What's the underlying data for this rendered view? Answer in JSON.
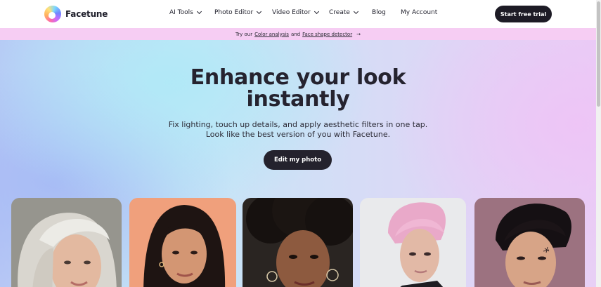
{
  "header": {
    "brand": "Facetune",
    "nav": [
      {
        "label": "AI Tools",
        "dropdown": true
      },
      {
        "label": "Photo Editor",
        "dropdown": true
      },
      {
        "label": "Video Editor",
        "dropdown": true
      },
      {
        "label": "Create",
        "dropdown": true
      },
      {
        "label": "Blog",
        "dropdown": false
      },
      {
        "label": "My Account",
        "dropdown": false
      }
    ],
    "cta": "Start free trial"
  },
  "promo": {
    "prefix": "Try our",
    "link1": "Color analysis",
    "middle": "and",
    "link2": "Face shape detector",
    "arrow": "→"
  },
  "hero": {
    "title_line1": "Enhance your look",
    "title_line2": "instantly",
    "subtitle_line1": "Fix lighting, touch up details, and apply aesthetic filters in one tap.",
    "subtitle_line2": "Look like the best version of you with Facetune.",
    "button": "Edit my photo"
  },
  "colors": {
    "brand_dark": "#1d1b25",
    "promo_bg": "#f6cdf3",
    "text": "#1f1f2b"
  },
  "icons": [
    "facetune-logo-icon",
    "chevron-down-icon",
    "arrow-right-icon"
  ]
}
